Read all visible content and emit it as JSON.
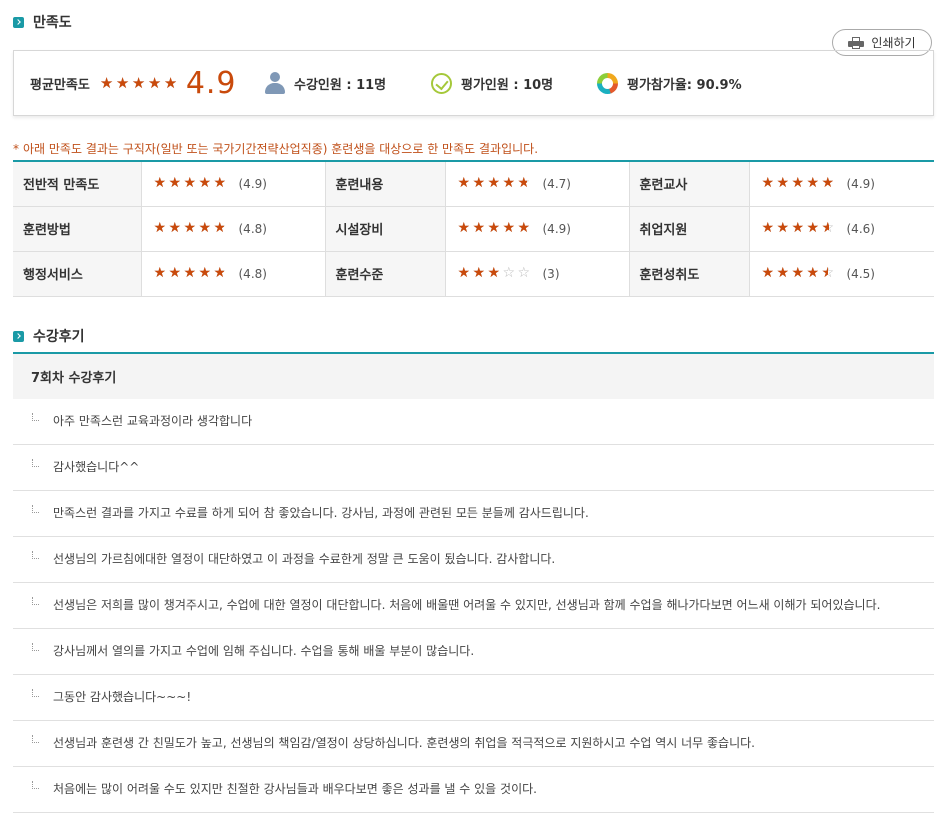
{
  "satisfaction": {
    "section_title": "만족도",
    "print_label": "인쇄하기",
    "avg_label": "평균만족도",
    "avg_score": "4.9",
    "avg_stars": 4.9,
    "enrolled": "수강인원 : 11명",
    "evaluators": "평가인원 : 10명",
    "participation": "평가참가율: 90.9%",
    "notice_mark": "*",
    "notice": "아래 만족도 결과는 구직자(일반 또는 국가기간전략산업직종) 훈련생을 대상으로 한 만족도 결과입니다."
  },
  "ratings": [
    [
      {
        "label": "전반적 만족도",
        "score": "(4.9)",
        "stars": 4.9
      },
      {
        "label": "훈련내용",
        "score": "(4.7)",
        "stars": 4.7
      },
      {
        "label": "훈련교사",
        "score": "(4.9)",
        "stars": 4.9
      }
    ],
    [
      {
        "label": "훈련방법",
        "score": "(4.8)",
        "stars": 4.8
      },
      {
        "label": "시설장비",
        "score": "(4.9)",
        "stars": 4.9
      },
      {
        "label": "취업지원",
        "score": "(4.6)",
        "stars": 4.6
      }
    ],
    [
      {
        "label": "행정서비스",
        "score": "(4.8)",
        "stars": 4.8
      },
      {
        "label": "훈련수준",
        "score": "(3)",
        "stars": 3
      },
      {
        "label": "훈련성취도",
        "score": "(4.5)",
        "stars": 4.5
      }
    ]
  ],
  "reviews": {
    "section_title": "수강후기",
    "round_title": "7회차 수강후기",
    "items": [
      "아주 만족스런 교육과정이라 생각합니다",
      "감사했습니다^^",
      "만족스런 결과를 가지고 수료를 하게 되어 참 좋았습니다. 강사님, 과정에 관련된 모든 분들께 감사드립니다.",
      "선생님의 가르침에대한 열정이 대단하였고 이 과정을 수료한게 정말 큰 도움이 됬습니다. 감사합니다.",
      "선생님은 저희를 많이 챙겨주시고, 수업에 대한 열정이 대단합니다. 처음에 배울땐 어려울 수 있지만, 선생님과 함께 수업을 해나가다보면 어느새 이해가 되어있습니다.",
      "강사님께서 열의를 가지고 수업에 임해 주십니다. 수업을 통해 배울 부분이 많습니다.",
      "그동안 감사했습니다~~~!",
      "선생님과 훈련생 간 친밀도가 높고, 선생님의 책임감/열정이 상당하십니다. 훈련생의 취업을 적극적으로 지원하시고 수업 역시 너무 좋습니다.",
      "처음에는 많이 어려울 수도 있지만 친절한 강사님들과 배우다보면 좋은 성과를 낼 수 있을 것이다."
    ]
  },
  "colors": {
    "accent": "#1a9aa6",
    "star": "#c94a0c",
    "notice": "#c0501a"
  },
  "icons": [
    "section-bullet-icon",
    "printer-icon",
    "person-icon",
    "check-circle-icon",
    "ring-chart-icon",
    "star-icon",
    "tree-line-icon"
  ]
}
